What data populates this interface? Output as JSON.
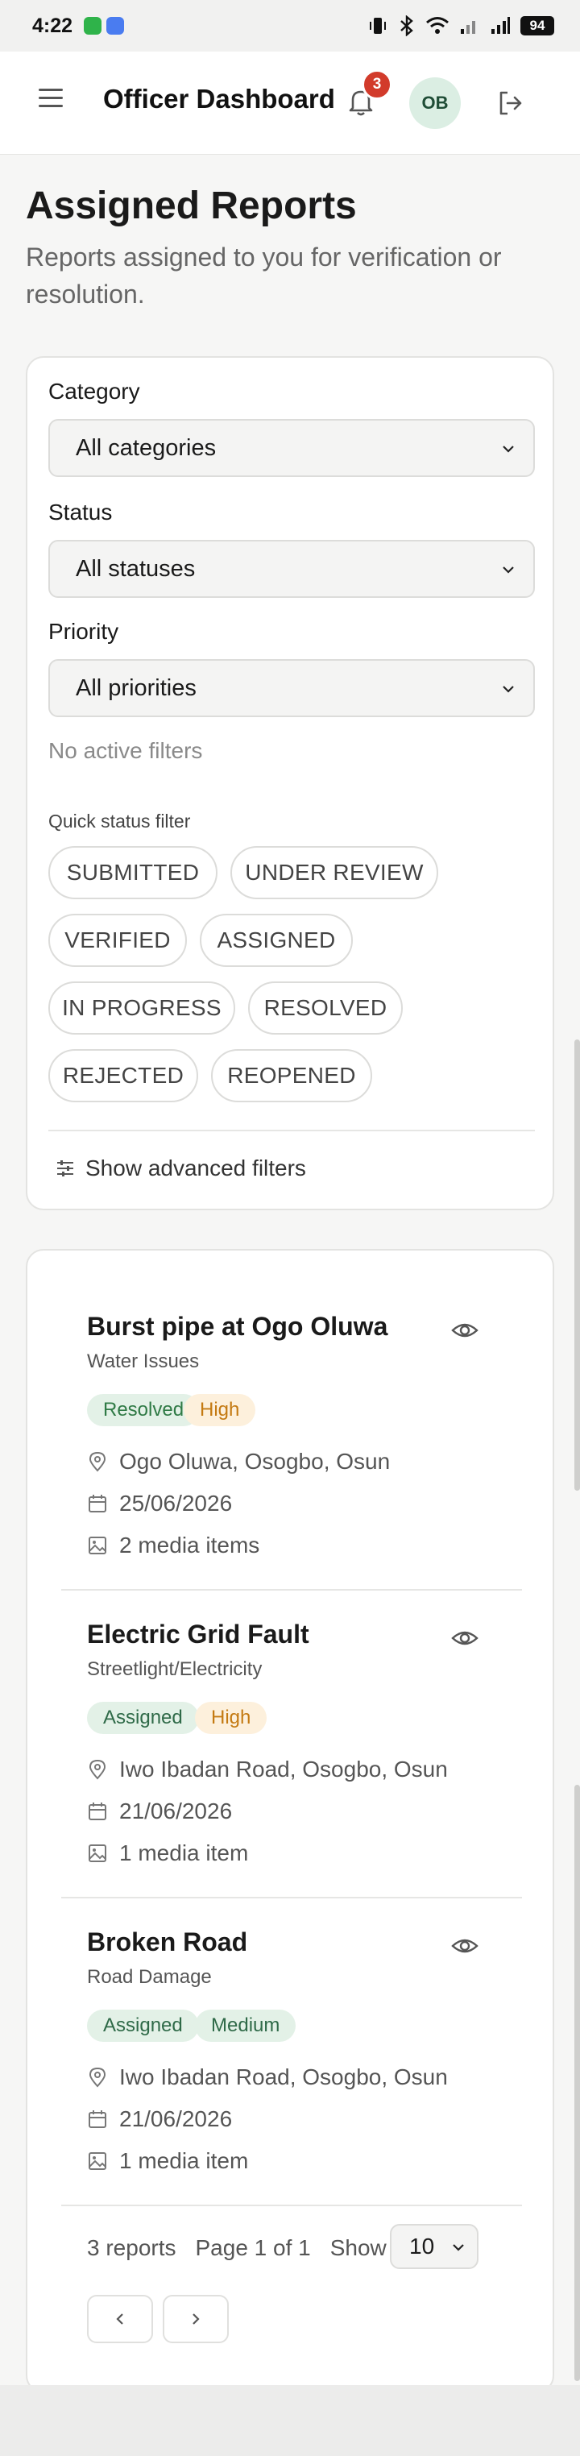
{
  "status_bar": {
    "time": "4:22",
    "battery": "94"
  },
  "header": {
    "title": "Officer Dashboard",
    "notification_count": "3",
    "avatar_initials": "OB"
  },
  "page": {
    "title": "Assigned Reports",
    "subtitle": "Reports assigned to you for verification or resolution."
  },
  "filters": {
    "category": {
      "label": "Category",
      "value": "All categories"
    },
    "status": {
      "label": "Status",
      "value": "All statuses"
    },
    "priority": {
      "label": "Priority",
      "value": "All priorities"
    },
    "no_active": "No active filters",
    "quick_label": "Quick status filter",
    "chips": [
      "SUBMITTED",
      "UNDER REVIEW",
      "VERIFIED",
      "ASSIGNED",
      "IN PROGRESS",
      "RESOLVED",
      "REJECTED",
      "REOPENED"
    ],
    "advanced_toggle": "Show advanced filters"
  },
  "reports": [
    {
      "title": "Burst pipe at Ogo Oluwa",
      "category": "Water Issues",
      "status": "Resolved",
      "priority": "High",
      "location": "Ogo Oluwa, Osogbo, Osun",
      "date": "25/06/2026",
      "media": "2 media items"
    },
    {
      "title": "Electric Grid Fault",
      "category": "Streetlight/Electricity",
      "status": "Assigned",
      "priority": "High",
      "location": "Iwo Ibadan Road, Osogbo, Osun",
      "date": "21/06/2026",
      "media": "1 media item"
    },
    {
      "title": "Broken Road",
      "category": "Road Damage",
      "status": "Assigned",
      "priority": "Medium",
      "location": "Iwo Ibadan Road, Osogbo, Osun",
      "date": "21/06/2026",
      "media": "1 media item"
    }
  ],
  "pagination": {
    "count": "3 reports",
    "page": "Page 1 of 1",
    "show_label": "Show",
    "page_size": "10"
  },
  "colors": {
    "resolved_bg": "#e3f1e7",
    "resolved_fg": "#2f7a45",
    "high_bg": "#fdf0dc",
    "high_fg": "#c47a12",
    "medium_bg": "#e3f1e7",
    "medium_fg": "#2f6a48",
    "assigned_bg": "#e3f1e7",
    "assigned_fg": "#2f6a48"
  }
}
